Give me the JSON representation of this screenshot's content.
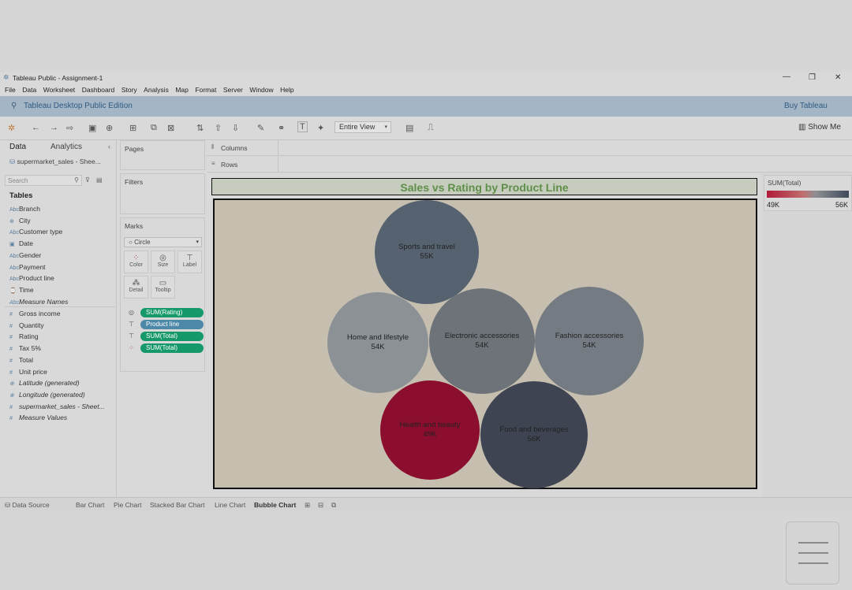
{
  "window": {
    "title": "Tableau Public - Assignment-1",
    "controls": {
      "minimize": "—",
      "restore": "❐",
      "close": "✕"
    }
  },
  "menu": [
    "File",
    "Data",
    "Worksheet",
    "Dashboard",
    "Story",
    "Analysis",
    "Map",
    "Format",
    "Server",
    "Window",
    "Help"
  ],
  "edition": {
    "label": "Tableau Desktop Public Edition",
    "buy": "Buy Tableau"
  },
  "toolbar": {
    "view_select": "Entire View",
    "show_me": "Show Me"
  },
  "sidebar": {
    "tabs": {
      "data": "Data",
      "analytics": "Analytics"
    },
    "datasource": "supermarket_sales - Shee...",
    "search_placeholder": "Search",
    "tables_heading": "Tables",
    "dimensions": [
      {
        "icon": "Abc",
        "label": "Branch",
        "italic": false
      },
      {
        "icon": "⊕",
        "label": "City",
        "italic": false
      },
      {
        "icon": "Abc",
        "label": "Customer type",
        "italic": false
      },
      {
        "icon": "▣",
        "label": "Date",
        "italic": false
      },
      {
        "icon": "Abc",
        "label": "Gender",
        "italic": false
      },
      {
        "icon": "Abc",
        "label": "Payment",
        "italic": false
      },
      {
        "icon": "Abc",
        "label": "Product line",
        "italic": false
      },
      {
        "icon": "⌚",
        "label": "Time",
        "italic": false
      },
      {
        "icon": "Abc",
        "label": "Measure Names",
        "italic": true
      }
    ],
    "measures": [
      {
        "icon": "#",
        "label": "Gross income",
        "italic": false
      },
      {
        "icon": "#",
        "label": "Quantity",
        "italic": false
      },
      {
        "icon": "#",
        "label": "Rating",
        "italic": false
      },
      {
        "icon": "#",
        "label": "Tax 5%",
        "italic": false
      },
      {
        "icon": "#",
        "label": "Total",
        "italic": false
      },
      {
        "icon": "#",
        "label": "Unit price",
        "italic": false
      },
      {
        "icon": "⊕",
        "label": "Latitude (generated)",
        "italic": true
      },
      {
        "icon": "⊕",
        "label": "Longitude (generated)",
        "italic": true
      },
      {
        "icon": "#",
        "label": "supermarket_sales - Sheet...",
        "italic": true
      },
      {
        "icon": "#",
        "label": "Measure Values",
        "italic": true
      }
    ]
  },
  "cards": {
    "pages": "Pages",
    "filters": "Filters",
    "marks": "Marks",
    "mark_type": "Circle",
    "buttons": {
      "color": "Color",
      "size": "Size",
      "label": "Label",
      "detail": "Detail",
      "tooltip": "Tooltip"
    },
    "pills": [
      {
        "label": "SUM(Rating)",
        "color": "#15996a"
      },
      {
        "label": "Product line",
        "color": "#4d88a8"
      },
      {
        "label": "SUM(Total)",
        "color": "#15996a"
      },
      {
        "label": "SUM(Total)",
        "color": "#15996a"
      }
    ]
  },
  "shelves": {
    "columns": "Columns",
    "rows": "Rows"
  },
  "legend": {
    "title": "SUM(Total)",
    "min_label": "49K",
    "max_label": "56K"
  },
  "chart_data": {
    "type": "bubble",
    "title": "Sales vs Rating by Product Line",
    "size_measure": "SUM(Rating)",
    "color_measure": "SUM(Total)",
    "color_range": [
      "#b01a38",
      "#3f4a5a"
    ],
    "bubbles": [
      {
        "name": "Sports and travel",
        "label": "55K",
        "total": 55000,
        "color": "#566270"
      },
      {
        "name": "Home and lifestyle",
        "label": "54K",
        "total": 54000,
        "color": "#8c9196"
      },
      {
        "name": "Electronic accessories",
        "label": "54K",
        "total": 54000,
        "color": "#6d7379"
      },
      {
        "name": "Fashion accessories",
        "label": "54K",
        "total": 54000,
        "color": "#757b82"
      },
      {
        "name": "Health and beauty",
        "label": "49K",
        "total": 49000,
        "color": "#8b0e2e"
      },
      {
        "name": "Food and beverages",
        "label": "56K",
        "total": 56000,
        "color": "#3e4452"
      }
    ]
  },
  "sheet_tabs": [
    {
      "label": "Data Source",
      "active": false
    },
    {
      "label": "Bar Chart",
      "active": false
    },
    {
      "label": "Pie Chart",
      "active": false
    },
    {
      "label": "Stacked Bar Chart",
      "active": false
    },
    {
      "label": "Line Chart",
      "active": false
    },
    {
      "label": "Bubble Chart",
      "active": true
    }
  ]
}
